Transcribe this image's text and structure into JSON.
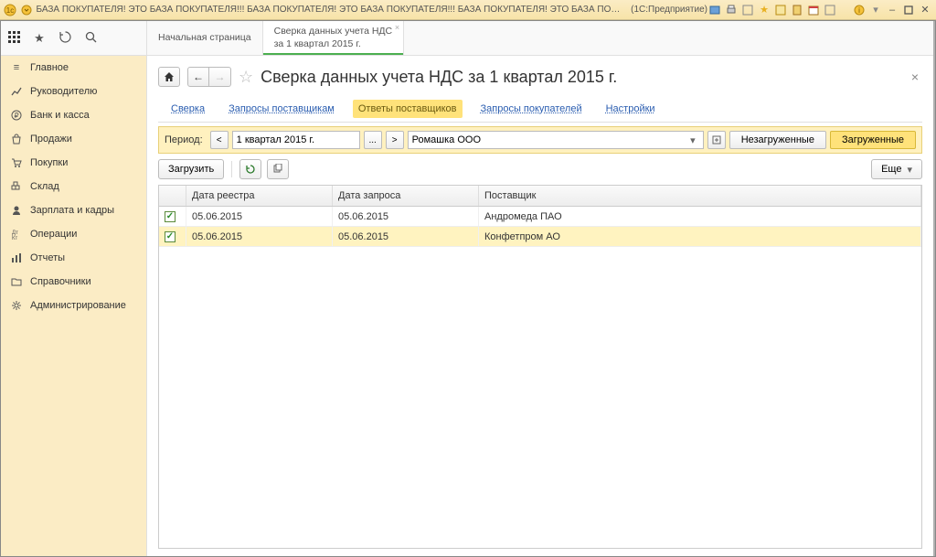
{
  "titlebar": {
    "title_scroll": "БАЗА ПОКУПАТЕЛЯ! ЭТО БАЗА ПОКУПАТЕЛЯ!!! БАЗА ПОКУПАТЕЛЯ! ЭТО БАЗА ПОКУПАТЕЛЯ!!! БАЗА ПОКУПАТЕЛЯ! ЭТО БАЗА ПОКУПАТ...",
    "system_label": "(1С:Предприятие)"
  },
  "page_tabs": {
    "home": "Начальная страница",
    "active_line1": "Сверка данных учета НДС",
    "active_line2": "за 1 квартал 2015 г."
  },
  "sidebar": {
    "items": [
      {
        "label": "Главное"
      },
      {
        "label": "Руководителю"
      },
      {
        "label": "Банк и касса"
      },
      {
        "label": "Продажи"
      },
      {
        "label": "Покупки"
      },
      {
        "label": "Склад"
      },
      {
        "label": "Зарплата и кадры"
      },
      {
        "label": "Операции"
      },
      {
        "label": "Отчеты"
      },
      {
        "label": "Справочники"
      },
      {
        "label": "Администрирование"
      }
    ]
  },
  "page": {
    "title": "Сверка данных учета НДС за 1 квартал 2015 г.",
    "subtabs": {
      "sverka": "Сверка",
      "zaprosy_post": "Запросы поставщикам",
      "otvety_post": "Ответы поставщиков",
      "zaprosy_pokup": "Запросы покупателей",
      "nastroiki": "Настройки"
    },
    "period": {
      "label": "Период:",
      "value": "1 квартал 2015 г.",
      "ellipsis": "...",
      "org": "Ромашка ООО"
    },
    "filters": {
      "unloaded": "Незагруженные",
      "loaded": "Загруженные"
    },
    "actions": {
      "load": "Загрузить",
      "more": "Еще"
    },
    "grid": {
      "columns": {
        "chk": "",
        "registry_date": "Дата реестра",
        "request_date": "Дата запроса",
        "supplier": "Поставщик"
      },
      "rows": [
        {
          "checked": true,
          "registry_date": "05.06.2015",
          "request_date": "05.06.2015",
          "supplier": "Андромеда ПАО"
        },
        {
          "checked": true,
          "registry_date": "05.06.2015",
          "request_date": "05.06.2015",
          "supplier": "Конфетпром АО"
        }
      ]
    }
  }
}
